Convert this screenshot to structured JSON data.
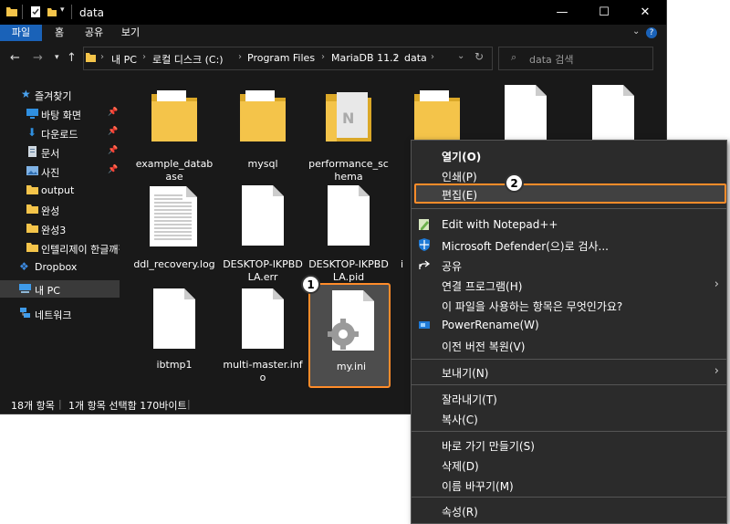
{
  "window": {
    "title": "data"
  },
  "ribbon": {
    "tabs": [
      {
        "label": "파일",
        "active": true
      },
      {
        "label": "홈"
      },
      {
        "label": "공유"
      },
      {
        "label": "보기"
      }
    ]
  },
  "address": {
    "crumbs": [
      "내 PC",
      "로컬 디스크 (C:)",
      "Program Files",
      "MariaDB 11.2",
      "data"
    ],
    "search_placeholder": "data 검색"
  },
  "sidebar": {
    "items": [
      {
        "label": "즐겨찾기",
        "icon": "star-icon"
      },
      {
        "label": "바탕 화면",
        "icon": "desktop-icon",
        "pinned": true
      },
      {
        "label": "다운로드",
        "icon": "download-icon",
        "pinned": true
      },
      {
        "label": "문서",
        "icon": "document-icon",
        "pinned": true
      },
      {
        "label": "사진",
        "icon": "picture-icon",
        "pinned": true
      },
      {
        "label": "output",
        "icon": "folder-icon"
      },
      {
        "label": "완성",
        "icon": "folder-icon"
      },
      {
        "label": "완성3",
        "icon": "folder-icon"
      },
      {
        "label": "인텔리제이 한글깨짐",
        "icon": "folder-icon"
      },
      {
        "label": "Dropbox",
        "icon": "dropbox-icon"
      },
      {
        "label": "내 PC",
        "icon": "pc-icon",
        "selected": true
      },
      {
        "label": "네트워크",
        "icon": "network-icon"
      }
    ]
  },
  "files": [
    {
      "name": "example_database",
      "type": "folder"
    },
    {
      "name": "mysql",
      "type": "folder"
    },
    {
      "name": "performance_schema",
      "type": "folder-onenote"
    },
    {
      "name": "",
      "type": "folder"
    },
    {
      "name": "",
      "type": "file"
    },
    {
      "name": "",
      "type": "file"
    },
    {
      "name": "ddl_recovery.log",
      "type": "text"
    },
    {
      "name": "DESKTOP-IKPBDLA.err",
      "type": "file"
    },
    {
      "name": "DESKTOP-IKPBDLA.pid",
      "type": "file"
    },
    {
      "name": "i",
      "type": "file"
    },
    {
      "name": "ibtmp1",
      "type": "file"
    },
    {
      "name": "multi-master.info",
      "type": "file"
    },
    {
      "name": "my.ini",
      "type": "settings",
      "selected": true
    }
  ],
  "status": {
    "count": "18개 항목",
    "selection": "1개 항목 선택함 170바이트"
  },
  "context_menu": {
    "items": [
      {
        "label": "열기(O)",
        "bold": true
      },
      {
        "label": "인쇄(P)"
      },
      {
        "label": "편집(E)",
        "highlight": true
      },
      {
        "label": "Edit with Notepad++",
        "icon": "notepadpp-icon"
      },
      {
        "label": "Microsoft Defender(으)로 검사...",
        "icon": "defender-icon"
      },
      {
        "label": "공유",
        "icon": "share-icon"
      },
      {
        "label": "연결 프로그램(H)",
        "submenu": true
      },
      {
        "label": "이 파일을 사용하는 항목은 무엇인가요?"
      },
      {
        "label": "PowerRename(W)",
        "icon": "powerrename-icon"
      },
      {
        "label": "이전 버전 복원(V)"
      },
      {
        "label": "보내기(N)",
        "submenu": true
      },
      {
        "label": "잘라내기(T)"
      },
      {
        "label": "복사(C)"
      },
      {
        "label": "바로 가기 만들기(S)"
      },
      {
        "label": "삭제(D)"
      },
      {
        "label": "이름 바꾸기(M)"
      },
      {
        "label": "속성(R)"
      }
    ]
  },
  "callouts": [
    "1",
    "2"
  ],
  "colors": {
    "accent": "#ff8c2a",
    "ribbon_active": "#1a62b8",
    "folder": "#f4c44a"
  }
}
